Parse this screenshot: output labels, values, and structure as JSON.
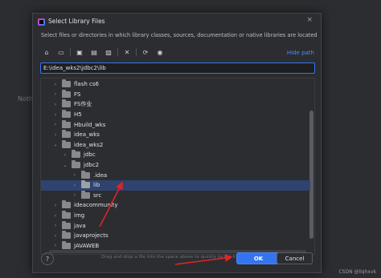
{
  "background": {
    "hint_text": "Noth",
    "watermark": "CSDN @liqhxvk"
  },
  "dialog": {
    "title": "Select Library Files",
    "close_glyph": "×",
    "description": "Select files or directories in which library classes, sources, documentation or native libraries are located",
    "hide_path_label": "Hide path",
    "path_value": "E:\\idea_wks2\\jdbc2\\lib",
    "drag_hint": "Drag and drop a file into the space above to quickly locate it in the tree",
    "help_label": "?",
    "ok_label": "OK",
    "cancel_label": "Cancel"
  },
  "toolbar": [
    {
      "name": "home-icon",
      "glyph": "⌂"
    },
    {
      "name": "desktop-icon",
      "glyph": "▭"
    },
    {
      "name": "project-folder-icon",
      "glyph": "▣"
    },
    {
      "name": "module-folder-icon",
      "glyph": "▤"
    },
    {
      "name": "new-folder-icon",
      "glyph": "▨"
    },
    {
      "name": "delete-icon",
      "glyph": "✕"
    },
    {
      "name": "refresh-icon",
      "glyph": "⟳"
    },
    {
      "name": "show-hidden-icon",
      "glyph": "◉"
    }
  ],
  "tree": [
    {
      "label": "flash cs6",
      "chev": "›",
      "indent": 0
    },
    {
      "label": "FS",
      "chev": "›",
      "indent": 0
    },
    {
      "label": "FS作业",
      "chev": "›",
      "indent": 0
    },
    {
      "label": "H5",
      "chev": "›",
      "indent": 0
    },
    {
      "label": "Hbuild_wks",
      "chev": "›",
      "indent": 0
    },
    {
      "label": "idea_wks",
      "chev": "›",
      "indent": 0
    },
    {
      "label": "idea_wks2",
      "chev": "⌄",
      "indent": 0
    },
    {
      "label": "jdbc",
      "chev": "›",
      "indent": 1
    },
    {
      "label": "jdbc2",
      "chev": "⌄",
      "indent": 1
    },
    {
      "label": ".idea",
      "chev": "›",
      "indent": 2
    },
    {
      "label": "lib",
      "chev": "›",
      "indent": 2,
      "selected": true
    },
    {
      "label": "src",
      "chev": "›",
      "indent": 2
    },
    {
      "label": "ideacommunity",
      "chev": "›",
      "indent": 0
    },
    {
      "label": "img",
      "chev": "›",
      "indent": 0
    },
    {
      "label": "java",
      "chev": "›",
      "indent": 0
    },
    {
      "label": "javaprojects",
      "chev": "›",
      "indent": 0
    },
    {
      "label": "JAVAWEB",
      "chev": "›",
      "indent": 0
    }
  ],
  "colors": {
    "accent": "#3574f0",
    "selection": "#2e436e",
    "annotation_arrow": "#e02424"
  }
}
